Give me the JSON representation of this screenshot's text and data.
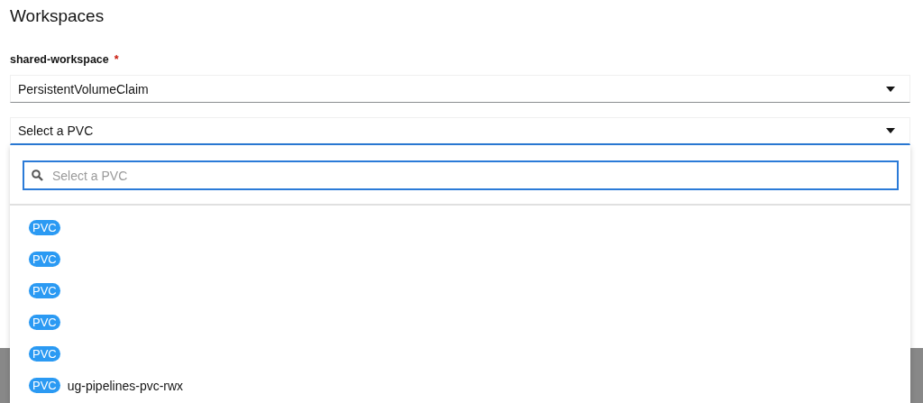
{
  "heading": "Workspaces",
  "workspace": {
    "label": "shared-workspace",
    "required_mark": "*",
    "type_select": {
      "value": "PersistentVolumeClaim"
    },
    "pvc_select": {
      "placeholder": "Select a PVC",
      "expanded": true,
      "search": {
        "placeholder": "Select a PVC"
      },
      "options": [
        {
          "badge": "PVC"
        },
        {
          "badge": "PVC"
        },
        {
          "badge": "PVC"
        },
        {
          "badge": "PVC"
        },
        {
          "badge": "PVC"
        },
        {
          "badge": "PVC",
          "name": "ug-pipelines-pvc-rwx"
        }
      ]
    }
  }
}
